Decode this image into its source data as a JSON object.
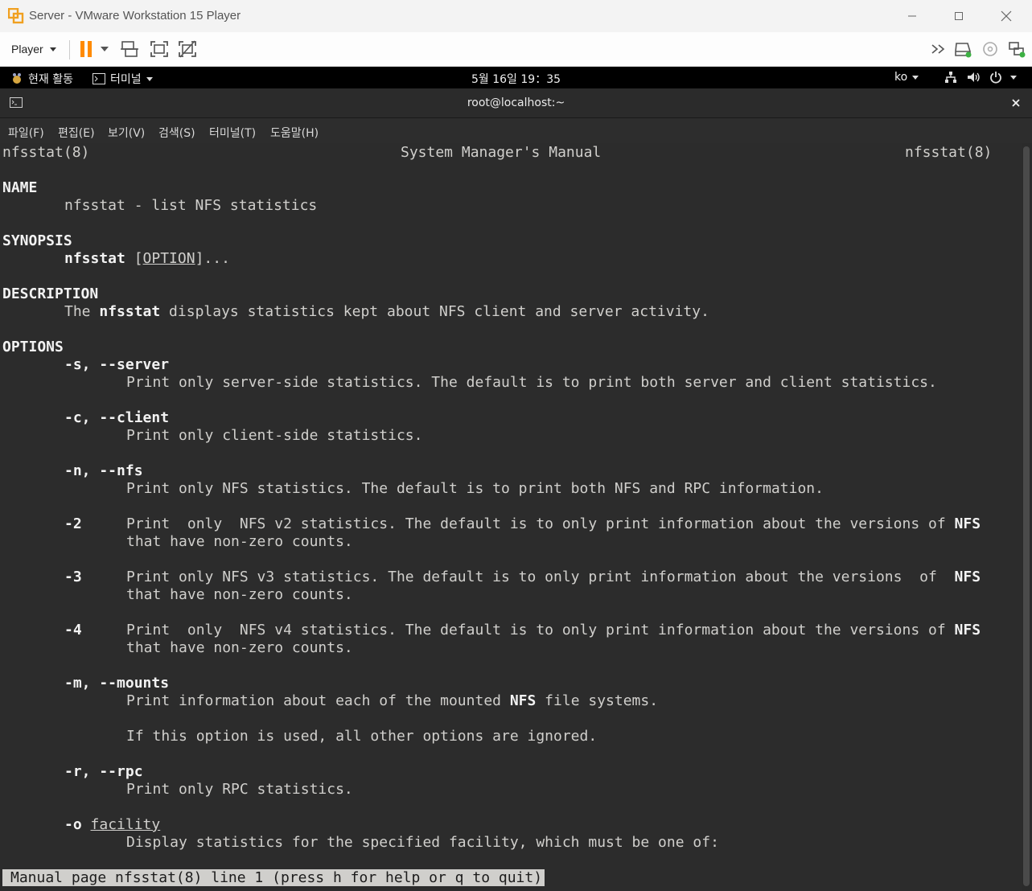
{
  "window": {
    "title": "Server - VMware Workstation 15 Player",
    "minimize_icon": "minimize-icon",
    "maximize_icon": "maximize-icon",
    "close_icon": "close-icon"
  },
  "toolbar": {
    "player_label": "Player",
    "icons": [
      "pause-icon",
      "send-ctrl-alt-del-icon",
      "fullscreen-icon",
      "unity-icon",
      "more-icon",
      "removable-disk-icon",
      "cd-icon",
      "network-icon"
    ],
    "pause_color": "#ff8a00"
  },
  "gnome": {
    "activities": "현재 활동",
    "app_menu": "터미널",
    "clock": "5월 16일  19：35",
    "input_method": "ko"
  },
  "terminal": {
    "title": "root@localhost:~",
    "menu": [
      "파일(F)",
      "편집(E)",
      "보기(V)",
      "검색(S)",
      "터미널(T)",
      "도움말(H)"
    ],
    "header_left": "nfsstat(8)",
    "header_center": "System Manager's Manual",
    "header_right": "nfsstat(8)",
    "name_heading": "NAME",
    "name_text": "nfsstat - list NFS statistics",
    "synopsis_heading": "SYNOPSIS",
    "synopsis_cmd": "nfsstat",
    "synopsis_open": " [",
    "synopsis_option": "OPTION",
    "synopsis_close": "]...",
    "description_heading": "DESCRIPTION",
    "description_pre": "The ",
    "description_cmd": "nfsstat",
    "description_post": " displays statistics kept about NFS client and server activity.",
    "options_heading": "OPTIONS",
    "opt_s_flag": "-s, --server",
    "opt_s_text": "Print only server-side statistics. The default is to print both server and client statistics.",
    "opt_c_flag": "-c, --client",
    "opt_c_text": "Print only client-side statistics.",
    "opt_n_flag": "-n, --nfs",
    "opt_n_text": "Print only NFS statistics. The default is to print both NFS and RPC information.",
    "opt_2_flag": "-2",
    "opt_2_text": "Print  only  NFS v2 statistics. The default is to only print information about the versions of ",
    "opt_2_nfs": "NFS",
    "opt_2_text2": "that have non-zero counts.",
    "opt_3_flag": "-3",
    "opt_3_text": "Print only NFS v3 statistics. The default is to only print information about the versions  of  ",
    "opt_3_nfs": "NFS",
    "opt_3_text2": "that have non-zero counts.",
    "opt_4_flag": "-4",
    "opt_4_text": "Print  only  NFS v4 statistics. The default is to only print information about the versions of ",
    "opt_4_nfs": "NFS",
    "opt_4_text2": "that have non-zero counts.",
    "opt_m_flag": "-m, --mounts",
    "opt_m_text_pre": "Print information about each of the mounted ",
    "opt_m_nfs": "NFS",
    "opt_m_text_post": " file systems.",
    "opt_m_text2": "If this option is used, all other options are ignored.",
    "opt_r_flag": "-r, --rpc",
    "opt_r_text": "Print only RPC statistics.",
    "opt_o_flag": "-o",
    "opt_o_arg": "facility",
    "opt_o_text": "Display statistics for the specified facility, which must be one of:",
    "status_line": "Manual page nfsstat(8) line 1 (press h for help or q to quit)"
  }
}
